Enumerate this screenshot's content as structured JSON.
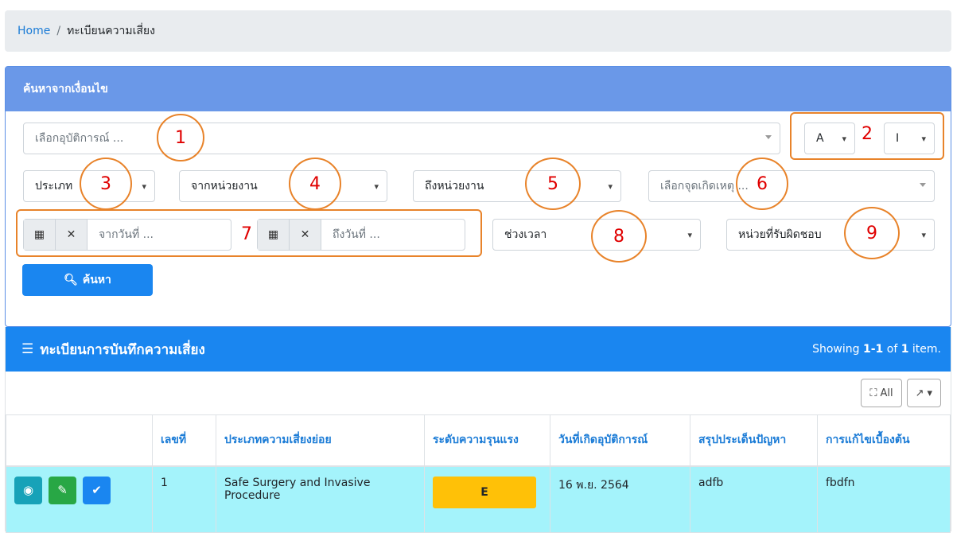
{
  "breadcrumb": {
    "home": "Home",
    "separator": "/",
    "current": "ทะเบียนความเสี่ยง"
  },
  "search_panel": {
    "title": "ค้นหาจากเงื่อนไข",
    "incident_placeholder": "เลือกอุบัติการณ์ ...",
    "select_a": "A",
    "select_i": "I",
    "type_select": "ประเภท",
    "from_unit": "จากหน่วยงาน",
    "to_unit": "ถึงหน่วยงาน",
    "location_placeholder": "เลือกจุดเกิดเหตุ ...",
    "from_date_placeholder": "จากวันที่ ...",
    "to_date_placeholder": "ถึงวันที่ ...",
    "period": "ช่วงเวลา",
    "responsible_unit": "หน่วยที่รับผิดชอบ",
    "search_button": "ค้นหา"
  },
  "annotations": [
    "1",
    "2",
    "3",
    "4",
    "5",
    "6",
    "7",
    "8",
    "9"
  ],
  "register": {
    "title": "ทะเบียนการบันทึกความเสี่ยง",
    "summary_prefix": "Showing",
    "summary_range": "1-1",
    "summary_of": "of",
    "summary_total": "1",
    "summary_suffix": "item.",
    "all_button": "All",
    "columns": [
      "",
      "เลขที่",
      "ประเภทความเสี่ยงย่อย",
      "ระดับความรุนแรง",
      "วันที่เกิดอุบัติการณ์",
      "สรุปประเด็นปัญหา",
      "การแก้ไขเบื้องต้น"
    ],
    "rows": [
      {
        "no": "1",
        "subtype": "Safe Surgery and Invasive Procedure",
        "severity": "E",
        "date": "16 พ.ย. 2564",
        "issue": "adfb",
        "fix": "fbdfn"
      }
    ]
  },
  "colors": {
    "primary": "#1a86f0",
    "header_light": "#6a98e8",
    "annotation": "#e8832a",
    "annotation_text": "#e00000",
    "row_bg": "#a4f3fb",
    "badge": "#ffc107",
    "view_btn": "#17a2b8",
    "edit_btn": "#28a745",
    "check_btn": "#1a86f0"
  }
}
